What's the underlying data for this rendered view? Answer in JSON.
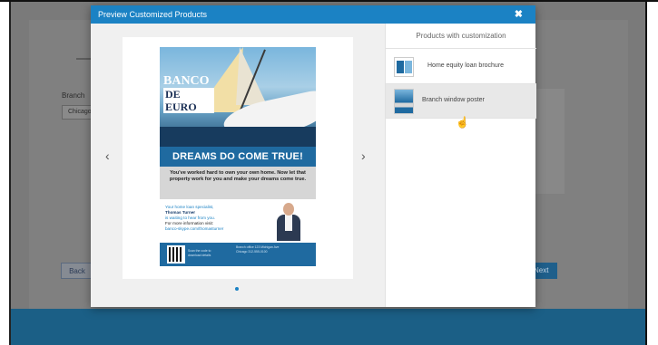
{
  "background": {
    "branch_label": "Branch",
    "branch_value": "Chicago",
    "back_label": "Back",
    "next_label": "Next"
  },
  "modal": {
    "title": "Preview Customized Products",
    "close_icon": "close-icon",
    "close_glyph": "✖",
    "prev_glyph": "‹",
    "next_glyph": "›"
  },
  "poster": {
    "bank_name_line1": "BANCO",
    "bank_name_line2": "DE EURO",
    "headline": "DREAMS DO COME TRUE!",
    "body": "You've worked hard to own your own home. Now let that property work for you and make your dreams come true.",
    "contact_intro": "Your home loan specialist,",
    "contact_name": "Thomas Turner",
    "contact_waiting": "is waiting to hear from you.",
    "contact_more": "For more information visit:",
    "contact_url": "banco-skype.com/thomasturner",
    "footer_note": "Scan the code to download details",
    "footer_address": "Branch office 123 Michigan Ave Chicago 312-555-0100"
  },
  "products": {
    "header": "Products with customization",
    "items": [
      {
        "label": "Home equity loan brochure",
        "icon": "brochure-thumbnail"
      },
      {
        "label": "Branch window poster",
        "icon": "poster-thumbnail",
        "selected": true
      }
    ]
  },
  "colors": {
    "modal_header": "#1b82c4",
    "poster_blue": "#1f6aa0",
    "footer_bar": "#1b5f86"
  }
}
